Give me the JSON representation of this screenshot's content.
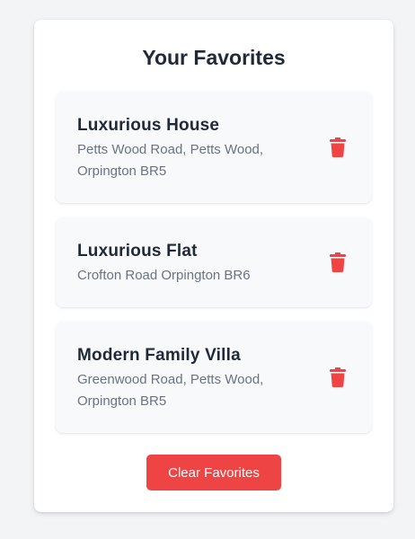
{
  "favorites": {
    "title": "Your Favorites",
    "items": [
      {
        "title": "Luxurious House",
        "address": "Petts Wood Road, Petts Wood, Orpington BR5",
        "action_icon": "trash-icon"
      },
      {
        "title": "Luxurious Flat",
        "address": "Crofton Road Orpington BR6",
        "action_icon": "trash-icon"
      },
      {
        "title": "Modern Family Villa",
        "address": "Greenwood Road, Petts Wood, Orpington BR5",
        "action_icon": "trash-icon"
      }
    ],
    "clear_label": "Clear Favorites"
  },
  "colors": {
    "danger": "#ef4444",
    "card_bg": "#f8f9fb",
    "page_bg": "#f3f4f6",
    "text_primary": "#1f2937",
    "text_secondary": "#6b7280"
  }
}
